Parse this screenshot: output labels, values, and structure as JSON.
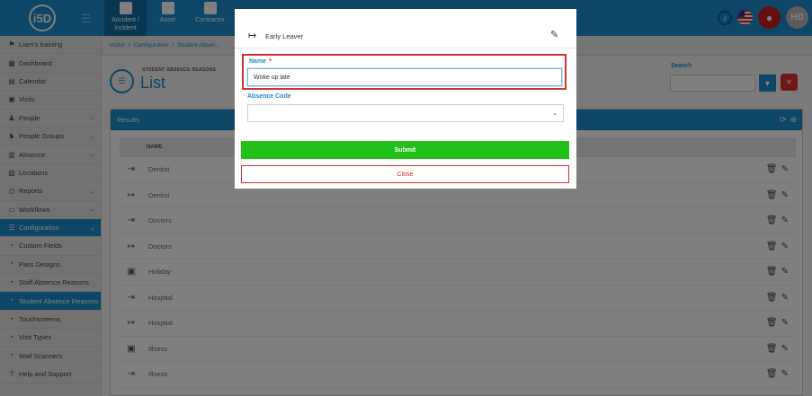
{
  "topbar": {
    "logo": "i5D",
    "modules": [
      {
        "label": "Accident / Incident",
        "icon": "first-aid-icon",
        "active": true
      },
      {
        "label": "Asset",
        "icon": "boxes-icon",
        "active": false
      },
      {
        "label": "Contractor",
        "icon": "hardhat-icon",
        "active": false
      }
    ],
    "user_initials": "HD"
  },
  "sidebar": {
    "items": [
      {
        "label": "Liam's training",
        "icon": "signpost-icon",
        "type": "top"
      },
      {
        "label": "Dashboard",
        "icon": "dashboard-icon"
      },
      {
        "label": "Calendar",
        "icon": "calendar-icon"
      },
      {
        "label": "Visits",
        "icon": "visits-icon"
      },
      {
        "label": "People",
        "icon": "people-icon",
        "chevron": true
      },
      {
        "label": "People Groups",
        "icon": "people-groups-icon",
        "chevron": true
      },
      {
        "label": "Absence",
        "icon": "absence-icon",
        "chevron": true
      },
      {
        "label": "Locations",
        "icon": "building-icon"
      },
      {
        "label": "Reports",
        "icon": "clock-icon",
        "chevron": true
      },
      {
        "label": "Workflows",
        "icon": "workflow-icon",
        "chevron": true
      },
      {
        "label": "Configuration",
        "icon": "config-icon",
        "chevron": true,
        "active": true
      },
      {
        "label": "Custom Fields",
        "sub": true
      },
      {
        "label": "Pass Designs",
        "sub": true
      },
      {
        "label": "Staff Absence Reasons",
        "sub": true
      },
      {
        "label": "Student Absence Reasons",
        "sub": true,
        "active": true
      },
      {
        "label": "Touchscreens",
        "sub": true
      },
      {
        "label": "Visit Types",
        "sub": true
      },
      {
        "label": "Wall Scanners",
        "sub": true
      },
      {
        "label": "Help and Support",
        "icon": "help-icon"
      }
    ]
  },
  "breadcrumb": {
    "items": [
      "Visitor",
      "/",
      "Configuration",
      "/",
      "Student Absen..."
    ]
  },
  "page": {
    "subtitle": "STUDENT ABSENCE REASONS",
    "title": "List",
    "search_label": "Search",
    "results_label": "Results",
    "col_name": "NAME"
  },
  "rows": [
    {
      "name": "Dentist",
      "icon": "sign-in-icon"
    },
    {
      "name": "Dentist",
      "icon": "sign-out-icon"
    },
    {
      "name": "Doctors",
      "icon": "sign-in-icon"
    },
    {
      "name": "Doctors",
      "icon": "sign-out-icon"
    },
    {
      "name": "Holiday",
      "icon": "calendar-x-icon"
    },
    {
      "name": "Hospital",
      "icon": "sign-in-icon"
    },
    {
      "name": "Hospital",
      "icon": "sign-out-icon"
    },
    {
      "name": "Illness",
      "icon": "calendar-x-icon"
    },
    {
      "name": "Illness",
      "icon": "sign-in-icon"
    }
  ],
  "modal": {
    "title": "Early Leaver",
    "name_label": "Name",
    "required_mark": "*",
    "name_value": "Woke up late",
    "code_label": "Absence Code",
    "code_value": "",
    "submit_label": "Submit",
    "close_label": "Close"
  }
}
